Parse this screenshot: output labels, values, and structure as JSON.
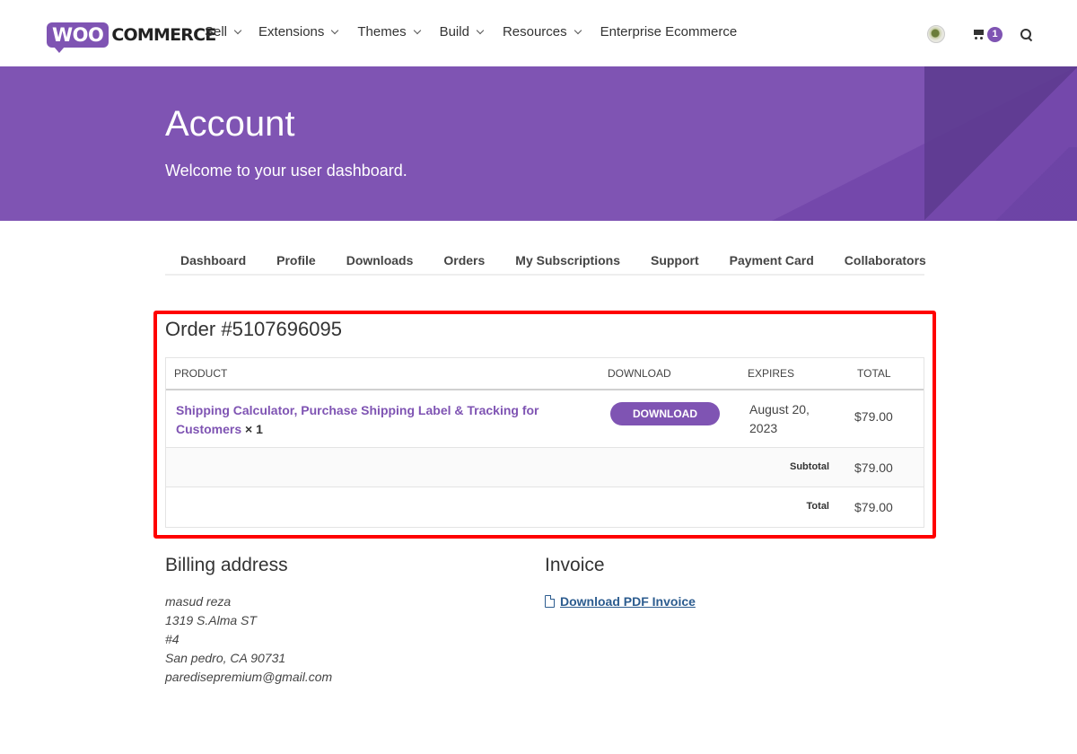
{
  "brand": {
    "logo_woo": "WOO",
    "logo_commerce": "COMMERCE"
  },
  "nav": {
    "items": [
      {
        "label": "Sell",
        "has_dropdown": true
      },
      {
        "label": "Extensions",
        "has_dropdown": true
      },
      {
        "label": "Themes",
        "has_dropdown": true
      },
      {
        "label": "Build",
        "has_dropdown": true
      },
      {
        "label": "Resources",
        "has_dropdown": true
      },
      {
        "label": "Enterprise Ecommerce",
        "has_dropdown": false
      }
    ],
    "cart_count": "1"
  },
  "hero": {
    "title": "Account",
    "subtitle": "Welcome to your user dashboard."
  },
  "tabs": [
    "Dashboard",
    "Profile",
    "Downloads",
    "Orders",
    "My Subscriptions",
    "Support",
    "Payment Card",
    "Collaborators"
  ],
  "order": {
    "title": "Order #5107696095",
    "columns": {
      "product": "PRODUCT",
      "download": "DOWNLOAD",
      "expires": "EXPIRES",
      "total": "TOTAL"
    },
    "item": {
      "name": "Shipping Calculator, Purchase Shipping Label & Tracking for Customers",
      "qty": "× 1",
      "download_label": "DOWNLOAD",
      "expires": "August 20, 2023",
      "total": "$79.00"
    },
    "subtotal_label": "Subtotal",
    "subtotal": "$79.00",
    "total_label": "Total",
    "total": "$79.00"
  },
  "billing": {
    "title": "Billing address",
    "lines": [
      "masud reza",
      "1319 S.Alma ST",
      "#4",
      "San pedro, CA 90731",
      "paredisepremium@gmail.com"
    ]
  },
  "invoice": {
    "title": "Invoice",
    "link_label": "Download PDF Invoice"
  },
  "colors": {
    "brand_purple": "#7f54b3",
    "highlight_red": "#ff0000",
    "link_blue": "#2c5c8f"
  }
}
